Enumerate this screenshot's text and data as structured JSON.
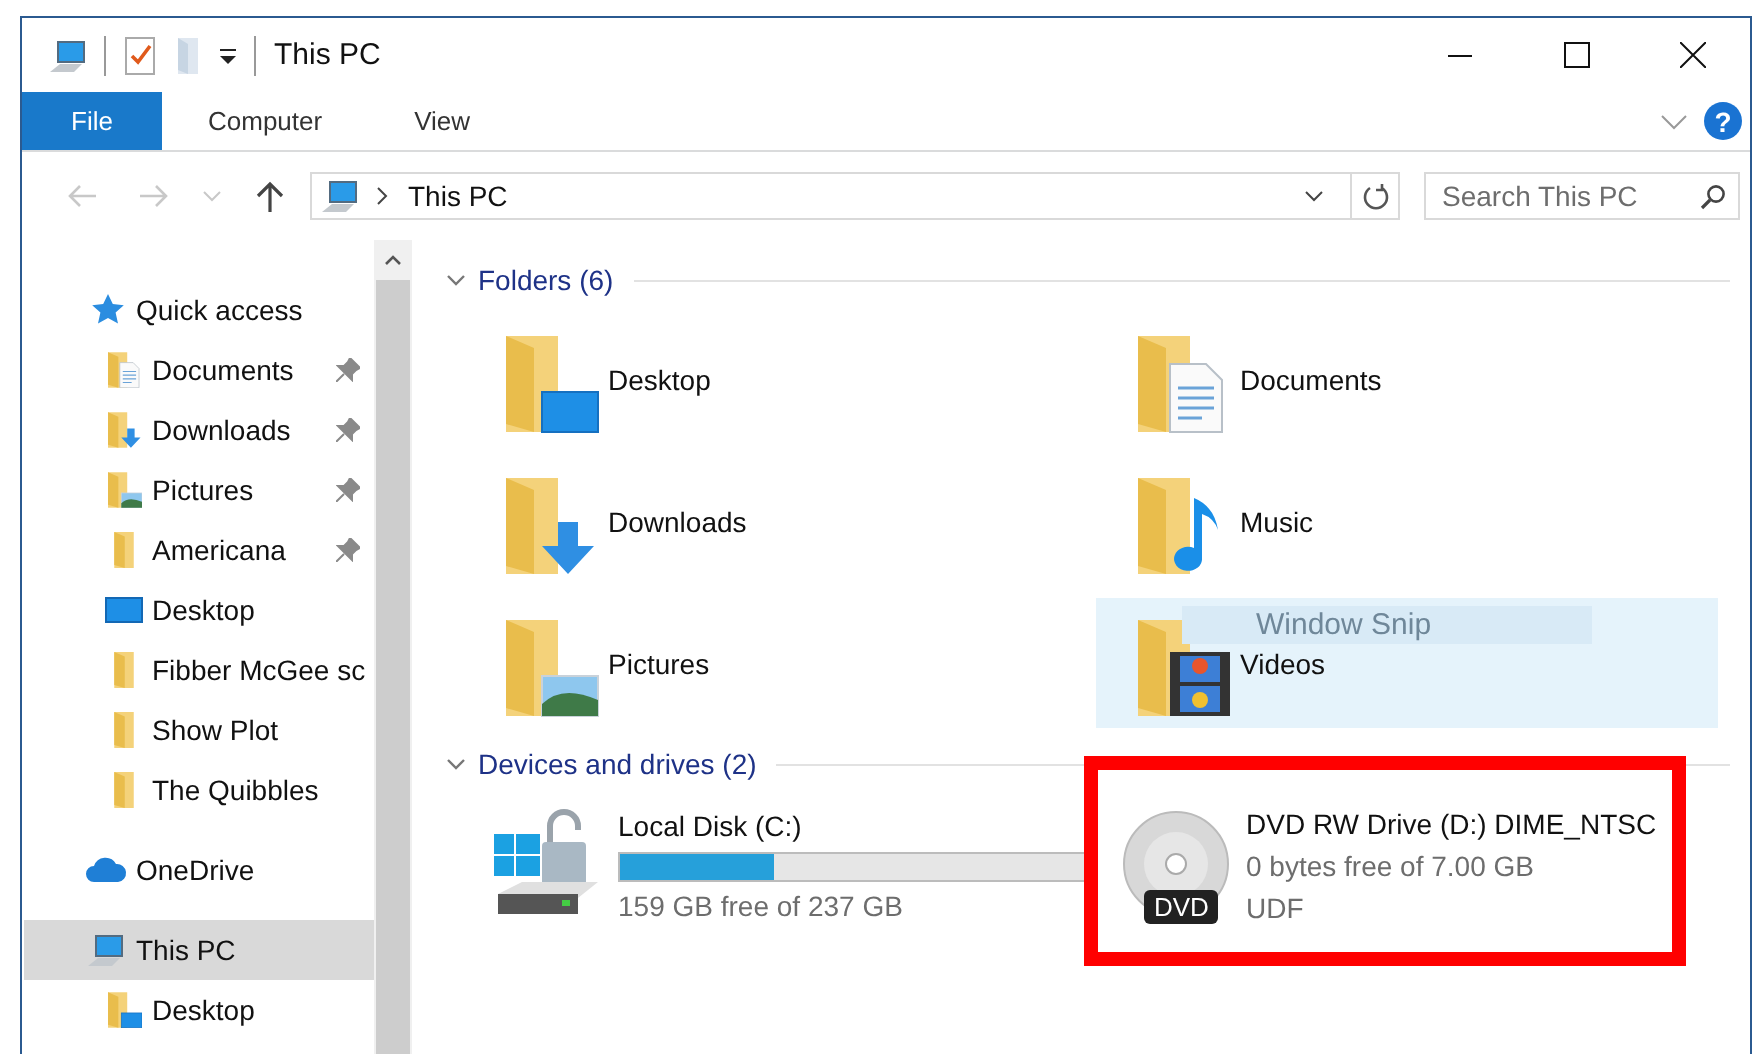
{
  "window": {
    "title": "This PC"
  },
  "quick_toolbar": [
    {
      "kind": "computer"
    },
    {
      "kind": "properties"
    },
    {
      "kind": "new-folder"
    },
    {
      "kind": "customize"
    }
  ],
  "ribbon": {
    "tabs": [
      {
        "label": "File",
        "kind": "file-menu"
      },
      {
        "label": "Computer",
        "kind": "tab"
      },
      {
        "label": "View",
        "kind": "tab"
      }
    ],
    "expanded": false,
    "help": "?"
  },
  "nav_buttons": [
    {
      "kind": "back",
      "disabled": true
    },
    {
      "kind": "forward",
      "disabled": true
    },
    {
      "kind": "recent",
      "disabled": true
    },
    {
      "kind": "up",
      "disabled": false
    }
  ],
  "address": {
    "path": [
      "This PC"
    ]
  },
  "search": {
    "placeholder": "Search This PC"
  },
  "navigation": [
    {
      "label": "Quick access",
      "kind": "quick-access",
      "selected": false,
      "children": [
        {
          "label": "Documents",
          "kind": "documents",
          "pinned": true,
          "selected": false
        },
        {
          "label": "Downloads",
          "kind": "downloads",
          "pinned": true,
          "selected": false
        },
        {
          "label": "Pictures",
          "kind": "pictures",
          "pinned": true,
          "selected": false
        },
        {
          "label": "Americana",
          "kind": "folder",
          "pinned": true,
          "selected": false
        },
        {
          "label": "Desktop",
          "kind": "desktop",
          "pinned": false,
          "selected": false
        },
        {
          "label": "Fibber McGee sc",
          "kind": "folder",
          "pinned": false,
          "selected": false
        },
        {
          "label": "Show Plot",
          "kind": "folder",
          "pinned": false,
          "selected": false
        },
        {
          "label": "The Quibbles",
          "kind": "folder",
          "pinned": false,
          "selected": false
        }
      ]
    },
    {
      "label": "OneDrive",
      "kind": "onedrive",
      "selected": false
    },
    {
      "label": "This PC",
      "kind": "computer",
      "selected": true,
      "children": [
        {
          "label": "Desktop",
          "kind": "desktop-folder",
          "pinned": false,
          "selected": false
        }
      ]
    }
  ],
  "folders": {
    "title": "Folders (6)",
    "expanded": true,
    "items": [
      {
        "name": "Desktop",
        "kind": "desktop",
        "hovered": false
      },
      {
        "name": "Documents",
        "kind": "documents",
        "hovered": false
      },
      {
        "name": "Downloads",
        "kind": "downloads",
        "hovered": false
      },
      {
        "name": "Music",
        "kind": "music",
        "hovered": false
      },
      {
        "name": "Pictures",
        "kind": "pictures",
        "hovered": false
      },
      {
        "name": "Videos",
        "kind": "videos",
        "hovered": true
      }
    ]
  },
  "tooltip": {
    "text": "Window Snip"
  },
  "drives": {
    "title": "Devices and drives (2)",
    "expanded": true,
    "items": [
      {
        "name": "Local Disk (C:)",
        "kind": "disk",
        "level": 0.33,
        "free_space": "159 GB free of 237 GB",
        "highlighted": false
      },
      {
        "name": "DVD RW Drive (D:) DIME_NTSC",
        "kind": "dvd",
        "badge": "DVD",
        "free_space": "0 bytes free of 7.00 GB",
        "file_system": "UDF",
        "highlighted": true
      }
    ]
  }
}
